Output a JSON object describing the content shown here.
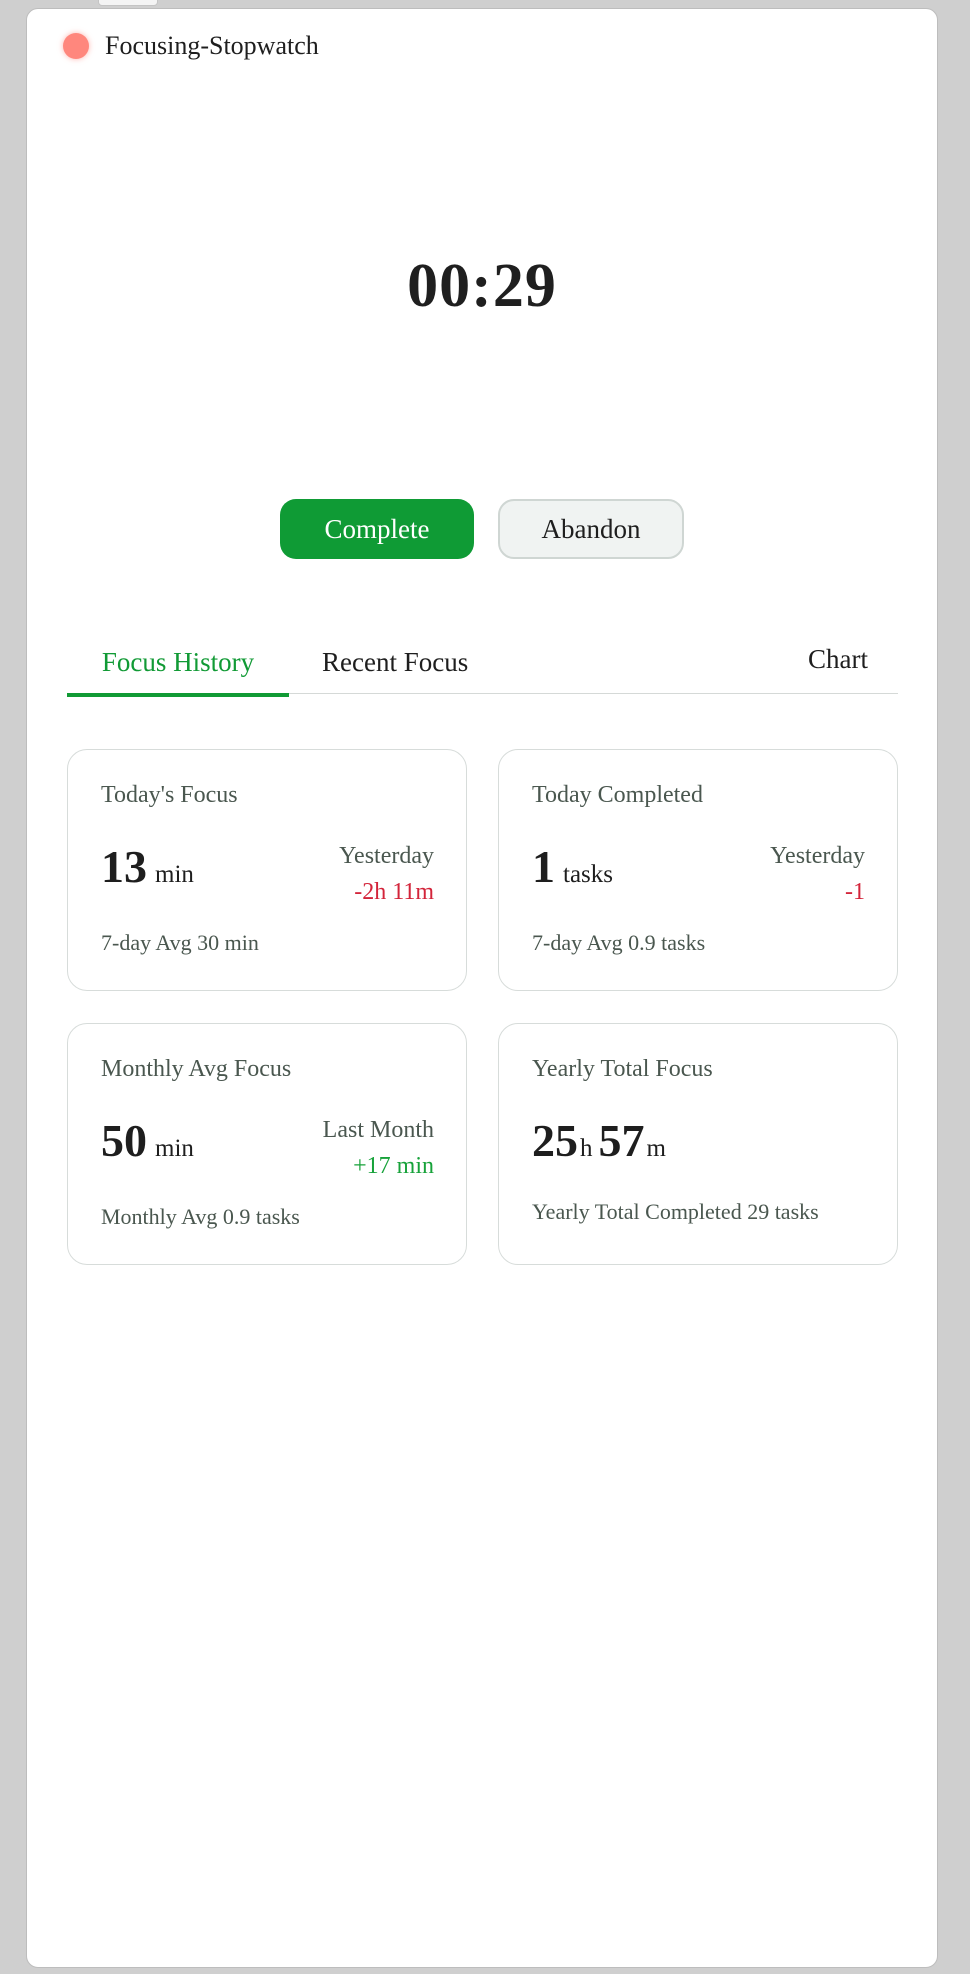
{
  "app": {
    "title": "Focusing-Stopwatch"
  },
  "timer": {
    "display": "00:29"
  },
  "actions": {
    "complete_label": "Complete",
    "abandon_label": "Abandon"
  },
  "tabs": [
    {
      "label": "Focus History",
      "active": true
    },
    {
      "label": "Recent Focus",
      "active": false
    },
    {
      "label": "Chart",
      "active": false
    }
  ],
  "cards": {
    "today_focus": {
      "title": "Today's Focus",
      "value": "13",
      "unit": "min",
      "compare_label": "Yesterday",
      "compare_delta": "-2h 11m",
      "footer": "7-day Avg 30 min"
    },
    "today_completed": {
      "title": "Today Completed",
      "value": "1",
      "unit": "tasks",
      "compare_label": "Yesterday",
      "compare_delta": "-1",
      "footer": "7-day Avg 0.9 tasks"
    },
    "monthly_avg": {
      "title": "Monthly Avg Focus",
      "value": "50",
      "unit": "min",
      "compare_label": "Last Month",
      "compare_delta": "+17 min",
      "footer": "Monthly Avg 0.9 tasks"
    },
    "yearly_total": {
      "title": "Yearly Total Focus",
      "hours": "25",
      "hours_unit": "h",
      "minutes": "57",
      "minutes_unit": "m",
      "footer": "Yearly Total Completed 29 tasks"
    }
  },
  "colors": {
    "accent": "#119a35",
    "negative": "#d3243a",
    "positive": "#17a23a",
    "status_dot": "#ff877d"
  }
}
